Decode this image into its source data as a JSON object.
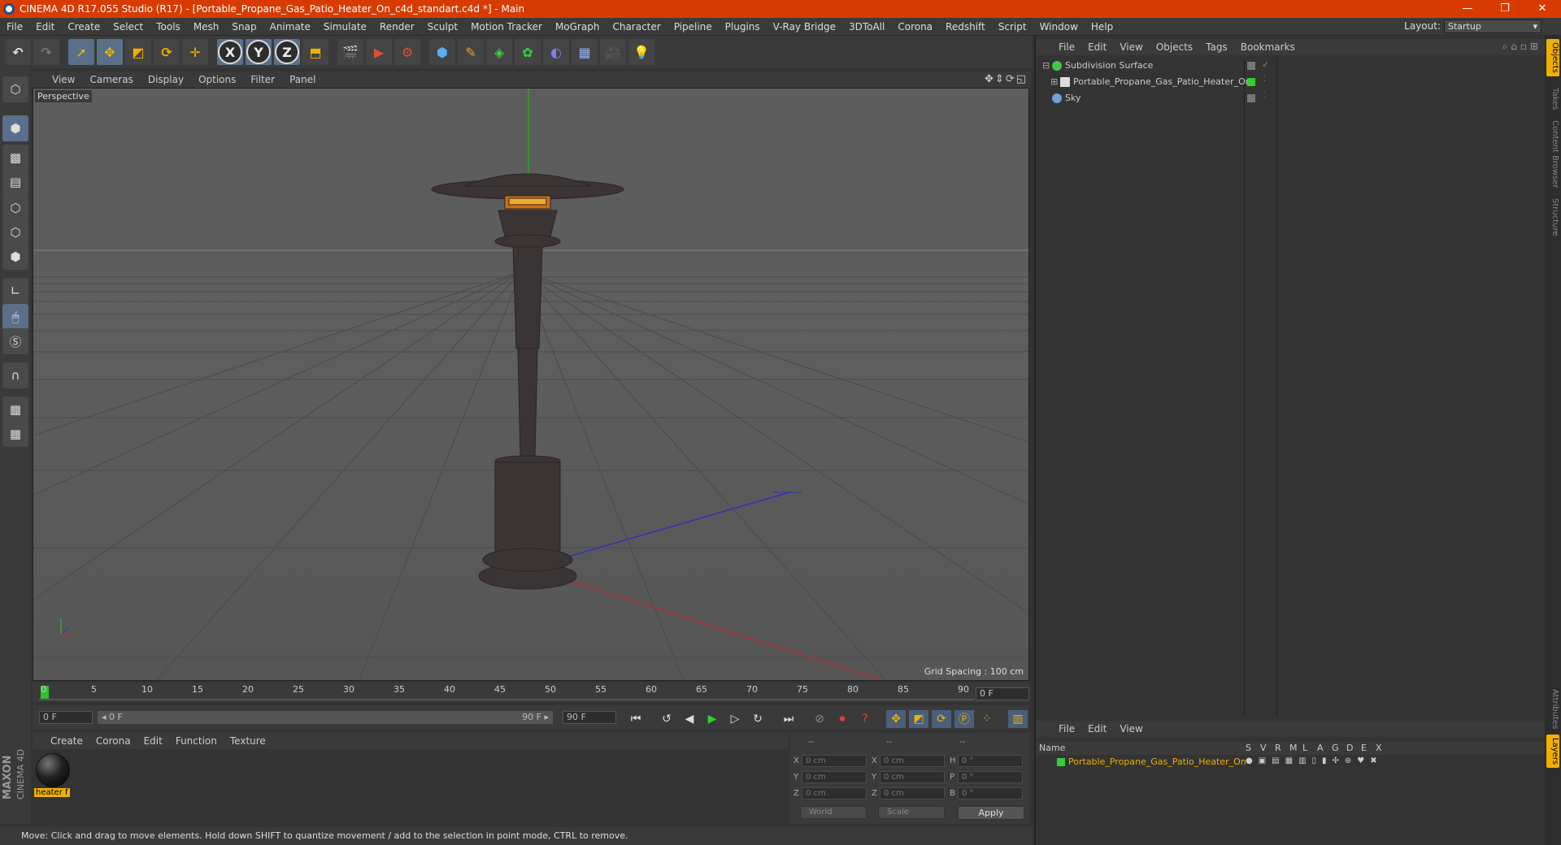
{
  "window": {
    "title": "CINEMA 4D R17.055 Studio (R17) - [Portable_Propane_Gas_Patio_Heater_On_c4d_standart.c4d *] - Main",
    "buttons": [
      "—",
      "❐",
      "✕"
    ]
  },
  "menubar": {
    "items": [
      "File",
      "Edit",
      "Create",
      "Select",
      "Tools",
      "Mesh",
      "Snap",
      "Animate",
      "Simulate",
      "Render",
      "Sculpt",
      "Motion Tracker",
      "MoGraph",
      "Character",
      "Pipeline",
      "Plugins",
      "V-Ray Bridge",
      "3DToAll",
      "Corona",
      "Redshift",
      "Script",
      "Window",
      "Help"
    ],
    "layout_label": "Layout:",
    "layout_value": "Startup"
  },
  "toolbar": {
    "axis_x": "X",
    "axis_y": "Y",
    "axis_z": "Z"
  },
  "viewport": {
    "menu": [
      "View",
      "Cameras",
      "Display",
      "Options",
      "Filter",
      "Panel"
    ],
    "label": "Perspective",
    "grid_spacing": "Grid Spacing : 100 cm",
    "nav_icons": "✥⇕⟳◱"
  },
  "timeline": {
    "ticks": [
      "0",
      "5",
      "10",
      "15",
      "20",
      "25",
      "30",
      "35",
      "40",
      "45",
      "50",
      "55",
      "60",
      "65",
      "70",
      "75",
      "80",
      "85",
      "90"
    ],
    "frame_end_box": "0 F",
    "start_field": "0 F",
    "range_start": "◂ 0 F",
    "range_end": "90 F ▸",
    "end_field": "90 F"
  },
  "material_manager": {
    "menu": [
      "Create",
      "Corona",
      "Edit",
      "Function",
      "Texture"
    ],
    "material_name": "heater f"
  },
  "coordinates": {
    "headers": [
      "--",
      "--",
      "--"
    ],
    "rows": [
      {
        "l1": "X",
        "v1": "0 cm",
        "l2": "X",
        "v2": "0 cm",
        "l3": "H",
        "v3": "0 °"
      },
      {
        "l1": "Y",
        "v1": "0 cm",
        "l2": "Y",
        "v2": "0 cm",
        "l3": "P",
        "v3": "0 °"
      },
      {
        "l1": "Z",
        "v1": "0 cm",
        "l2": "Z",
        "v2": "0 cm",
        "l3": "B",
        "v3": "0 °"
      }
    ],
    "mode_world": "World",
    "mode_scale": "Scale",
    "apply": "Apply"
  },
  "status": "Move: Click and drag to move elements. Hold down SHIFT to quantize movement / add to the selection in point mode, CTRL to remove.",
  "object_manager": {
    "menu": [
      "File",
      "Edit",
      "View",
      "Objects",
      "Tags",
      "Bookmarks"
    ],
    "objects": [
      {
        "name": "Subdivision Surface",
        "color": "#47c447"
      },
      {
        "name": "Portable_Propane_Gas_Patio_Heater_On",
        "color": "#dddddd"
      },
      {
        "name": "Sky",
        "color": "#6fa0d8"
      }
    ]
  },
  "layer_manager": {
    "menu": [
      "File",
      "Edit",
      "View"
    ],
    "columns": [
      "Name",
      "S",
      "V",
      "R",
      "M",
      "L",
      "A",
      "G",
      "D",
      "E",
      "X"
    ],
    "layer_name": "Portable_Propane_Gas_Patio_Heater_On"
  },
  "side_tabs": [
    "Objects",
    "Takes",
    "Content Browser",
    "Structure",
    "Attributes",
    "Layers"
  ],
  "brand": {
    "line1": "MAXON",
    "line2": "CINEMA 4D"
  },
  "colors": {
    "titlebar": "#d83b01",
    "accent": "#f0b000",
    "x_axis": "#b03030",
    "y_axis": "#30b030",
    "z_axis": "#3030c0"
  }
}
